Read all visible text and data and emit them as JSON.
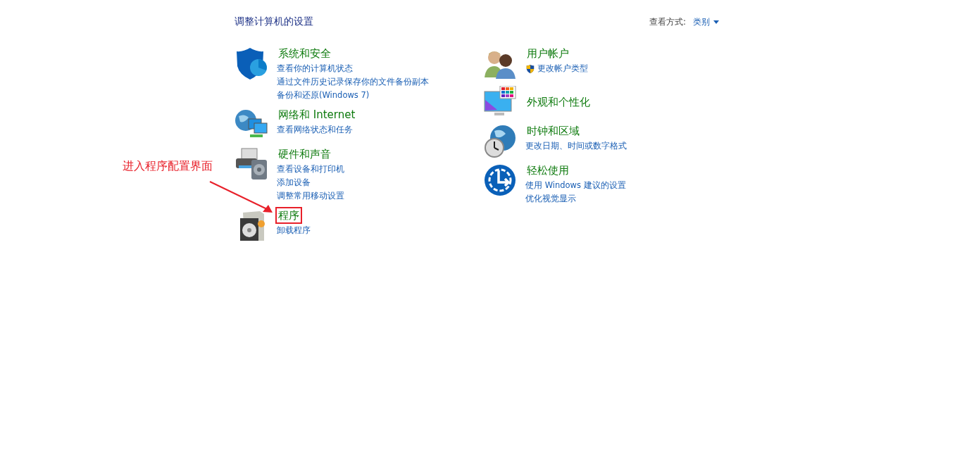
{
  "header": {
    "title": "调整计算机的设置",
    "view_by_label": "查看方式:",
    "view_by_value": "类别"
  },
  "columns": [
    {
      "categories": [
        {
          "kind": "shield",
          "title": "系统和安全",
          "highlighted": false,
          "links": [
            {
              "kind": "plain",
              "text": "查看你的计算机状态"
            },
            {
              "kind": "plain",
              "text": "通过文件历史记录保存你的文件备份副本"
            },
            {
              "kind": "plain",
              "text": "备份和还原(Windows 7)"
            }
          ]
        },
        {
          "kind": "network",
          "title": "网络和 Internet",
          "highlighted": false,
          "links": [
            {
              "kind": "plain",
              "text": "查看网络状态和任务"
            }
          ]
        },
        {
          "kind": "printer",
          "title": "硬件和声音",
          "highlighted": false,
          "links": [
            {
              "kind": "plain",
              "text": "查看设备和打印机"
            },
            {
              "kind": "plain",
              "text": "添加设备"
            },
            {
              "kind": "plain",
              "text": "调整常用移动设置"
            }
          ]
        },
        {
          "kind": "programs",
          "title": "程序",
          "highlighted": true,
          "links": [
            {
              "kind": "plain",
              "text": "卸载程序"
            }
          ]
        }
      ]
    },
    {
      "categories": [
        {
          "kind": "users",
          "title": "用户帐户",
          "highlighted": false,
          "links": [
            {
              "kind": "admin",
              "text": "更改帐户类型"
            }
          ]
        },
        {
          "kind": "monitor",
          "title": "外观和个性化",
          "highlighted": false
        },
        {
          "kind": "clock",
          "title": "时钟和区域",
          "highlighted": false,
          "links": [
            {
              "kind": "plain",
              "text": "更改日期、时间或数字格式"
            }
          ]
        },
        {
          "kind": "ease",
          "title": "轻松使用",
          "highlighted": false,
          "links": [
            {
              "kind": "plain",
              "text": "使用 Windows 建议的设置"
            },
            {
              "kind": "plain",
              "text": "优化视觉显示"
            }
          ]
        }
      ]
    }
  ],
  "annotation": {
    "text": "进入程序配置界面"
  }
}
